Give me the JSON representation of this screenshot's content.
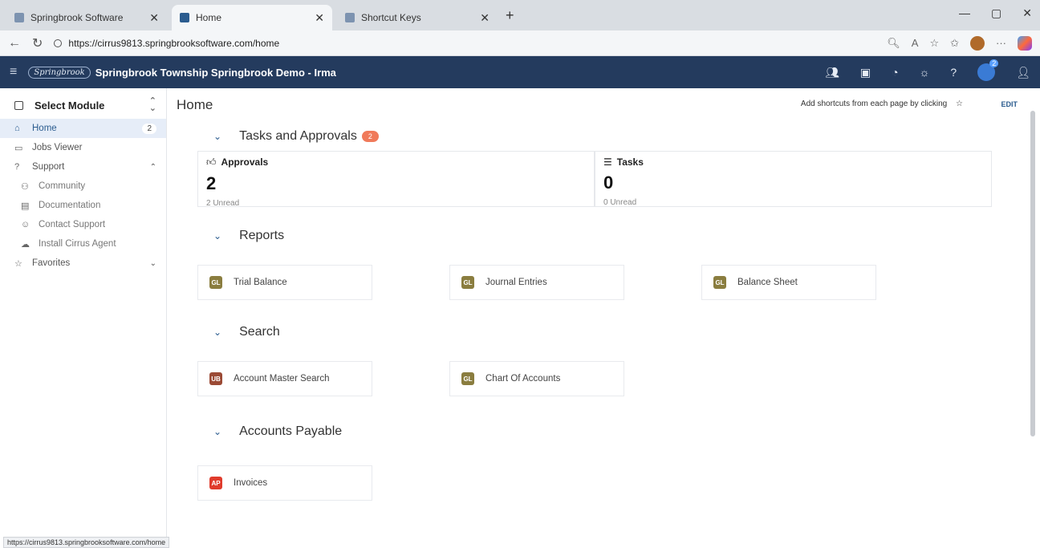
{
  "browser": {
    "tabs": [
      {
        "title": "Springbrook Software",
        "active": false
      },
      {
        "title": "Home",
        "active": true
      },
      {
        "title": "Shortcut Keys",
        "active": false
      }
    ],
    "url": "https://cirrus9813.springbrooksoftware.com/home",
    "status_url": "https://cirrus9813.springbrooksoftware.com/home"
  },
  "appbar": {
    "logo": "Springbrook",
    "title": "Springbrook Township Springbrook Demo - Irma",
    "notification_count": "2"
  },
  "sidebar": {
    "module_label": "Select Module",
    "items": [
      {
        "label": "Home",
        "count": "2"
      },
      {
        "label": "Jobs Viewer"
      },
      {
        "label": "Support"
      },
      {
        "label": "Community"
      },
      {
        "label": "Documentation"
      },
      {
        "label": "Contact Support"
      },
      {
        "label": "Install Cirrus Agent"
      },
      {
        "label": "Favorites"
      }
    ]
  },
  "main": {
    "page_title": "Home",
    "shortcut_hint": "Add shortcuts from each page by clicking",
    "edit_label": "EDIT",
    "tasks_section": {
      "title": "Tasks and Approvals",
      "badge": "2",
      "approvals": {
        "title": "Approvals",
        "value": "2",
        "sub": "2 Unread"
      },
      "tasks": {
        "title": "Tasks",
        "value": "0",
        "sub": "0 Unread"
      }
    },
    "reports_section": {
      "title": "Reports",
      "tiles": [
        {
          "module": "GL",
          "label": "Trial Balance"
        },
        {
          "module": "GL",
          "label": "Journal Entries"
        },
        {
          "module": "GL",
          "label": "Balance Sheet"
        }
      ]
    },
    "search_section": {
      "title": "Search",
      "tiles": [
        {
          "module": "UB",
          "label": "Account Master Search"
        },
        {
          "module": "GL",
          "label": "Chart Of Accounts"
        }
      ]
    },
    "ap_section": {
      "title": "Accounts Payable",
      "tiles": [
        {
          "module": "AP",
          "label": "Invoices"
        }
      ]
    }
  }
}
